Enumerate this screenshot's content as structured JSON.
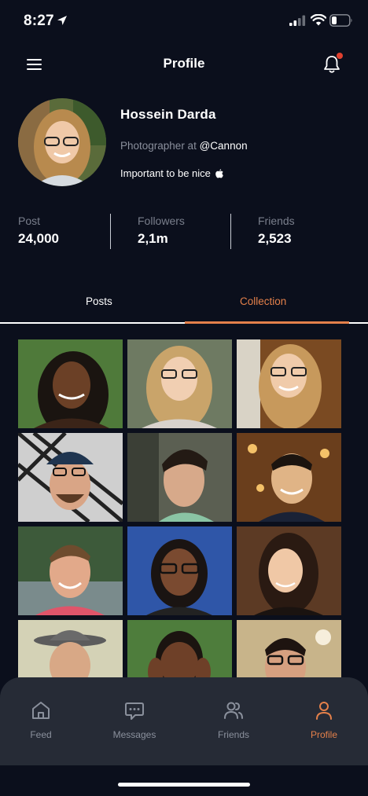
{
  "status_bar": {
    "time": "8:27"
  },
  "header": {
    "title": "Profile"
  },
  "profile": {
    "name": "Hossein Darda",
    "job_prefix": "Photographer at",
    "handle": "@Cannon",
    "bio": "Important to be nice"
  },
  "stats": [
    {
      "label": "Post",
      "value": "24,000"
    },
    {
      "label": "Followers",
      "value": "2,1m"
    },
    {
      "label": "Friends",
      "value": "2,523"
    }
  ],
  "tabs": {
    "posts": "Posts",
    "collection": "Collection",
    "active": "collection"
  },
  "nav": [
    {
      "label": "Feed",
      "icon": "home-icon"
    },
    {
      "label": "Messages",
      "icon": "message-icon"
    },
    {
      "label": "Friends",
      "icon": "users-icon"
    },
    {
      "label": "Profile",
      "icon": "user-icon",
      "active": true
    }
  ],
  "colors": {
    "background": "#0b0f1c",
    "accent": "#e4804a",
    "nav_bg": "#262b36",
    "notification_dot": "#e0402f"
  }
}
